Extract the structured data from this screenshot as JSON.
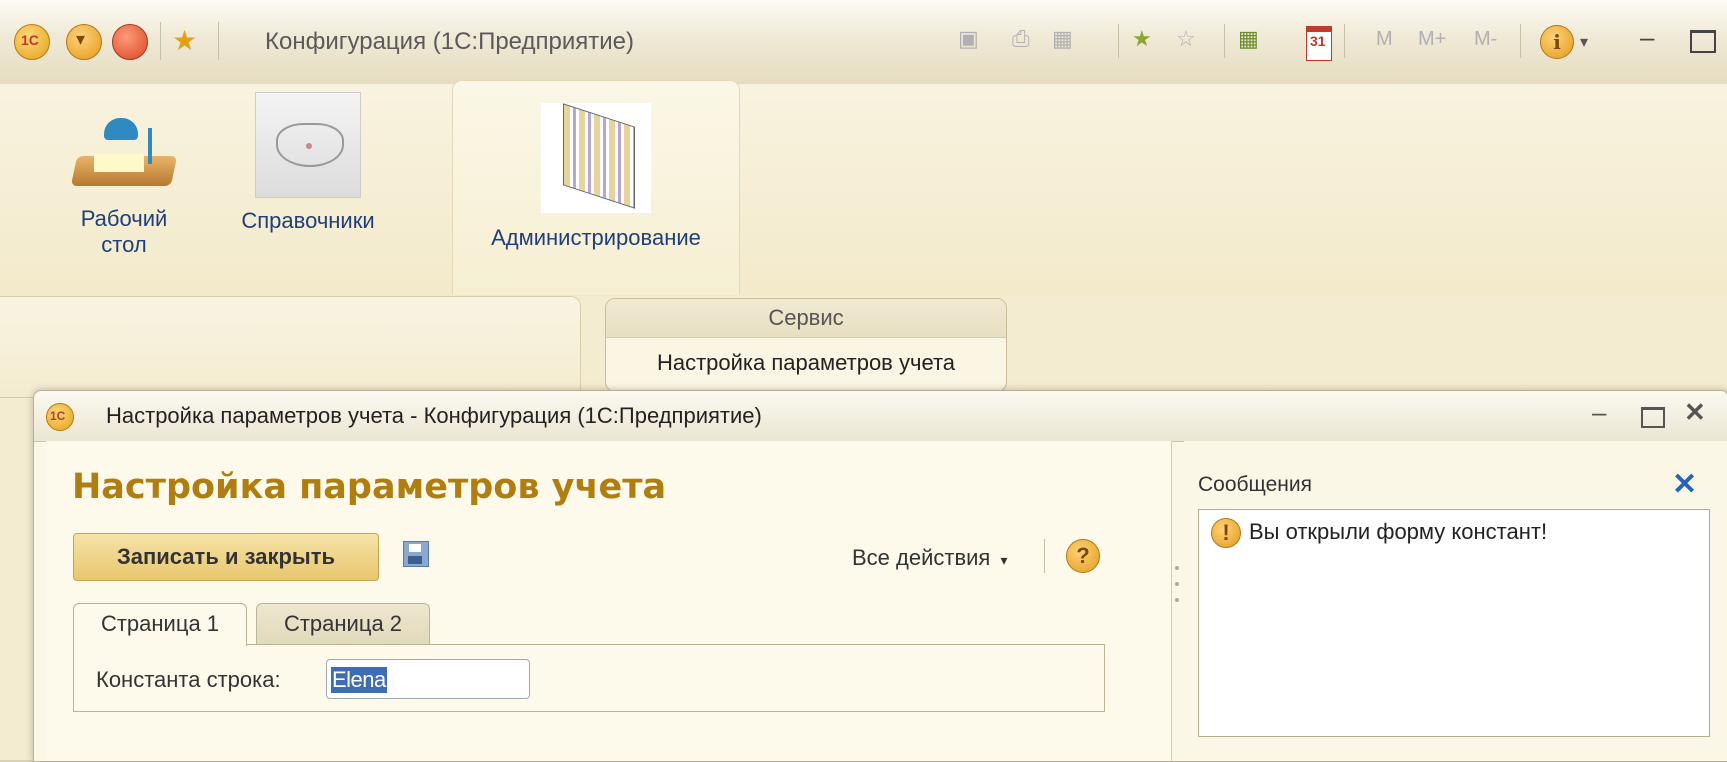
{
  "main_window": {
    "title": "Конфигурация  (1С:Предприятие)",
    "toolbar_icons": [
      "save-icon",
      "print-icon",
      "preview-icon",
      "favorite-add-icon",
      "favorite-icon",
      "calculator-icon",
      "calendar-icon",
      "memory-m-icon",
      "memory-plus-icon",
      "memory-minus-icon",
      "info-icon"
    ],
    "memory_labels": {
      "m": "M",
      "mplus": "M+",
      "mminus": "M-"
    },
    "calendar_day": "31"
  },
  "sections": [
    {
      "label_line1": "Рабочий",
      "label_line2": "стол",
      "icon": "desk-lamp-icon"
    },
    {
      "label_line1": "Справочники",
      "label_line2": "",
      "icon": "cat-icon"
    },
    {
      "label_line1": "Администрирование",
      "label_line2": "",
      "icon": "folders-icon"
    }
  ],
  "service_group": {
    "header": "Сервис",
    "link": "Настройка параметров учета"
  },
  "child_window": {
    "title": "Настройка параметров учета - Конфигурация  (1С:Предприятие)",
    "form_title": "Настройка параметров учета",
    "write_close_label": "Записать и закрыть",
    "all_actions_label": "Все действия",
    "help_label": "?",
    "tabs": [
      {
        "label": "Страница 1",
        "active": true
      },
      {
        "label": "Страница 2",
        "active": false
      }
    ],
    "field": {
      "label": "Константа строка:",
      "value": "Elena"
    },
    "messages": {
      "title": "Сообщения",
      "items": [
        {
          "text": "Вы открыли форму констант!",
          "icon": "warning-icon"
        }
      ]
    }
  },
  "colors": {
    "form_title": "#b07e10",
    "link_blue": "#1f3f7a",
    "selection": "#3f6db4",
    "write_button": "#e8c66e"
  }
}
